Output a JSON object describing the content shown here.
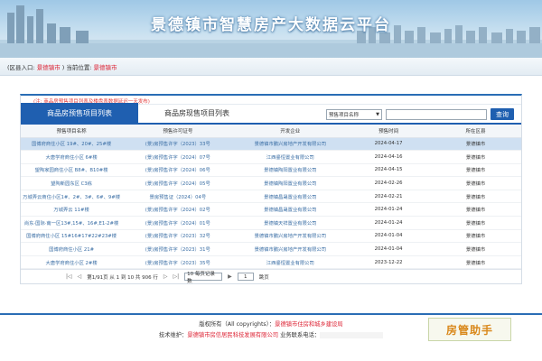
{
  "banner": {
    "title": "景德镇市智慧房产大数据云平台"
  },
  "location": {
    "region_prefix": "(区县入口:",
    "region_link": "景德镇市",
    "current_prefix": ")   当前位置:",
    "current_link": "景德镇市"
  },
  "note": "(注: 商品房预售项目列表及楼盘表数据延迟一天发布)",
  "tabs": [
    {
      "label": "商品房预售项目列表",
      "active": true
    },
    {
      "label": "商品房现售项目列表",
      "active": false
    }
  ],
  "search": {
    "select_value": "预售项目名称",
    "input_value": "",
    "button_label": "查询"
  },
  "table": {
    "headers": [
      "预售项目名称",
      "预售许可证号",
      "开发企业",
      "预售时间",
      "所在区县"
    ],
    "rows": [
      [
        "国博府商住小区 19#、20#、25#楼",
        "(景)房预售许字（2023）33号",
        "景德镇市鹏兴房地产开发有限公司",
        "2024-04-17",
        "景德镇市"
      ],
      [
        "大唐学府商住小区 6#楼",
        "(景)房预售许字（2024）07号",
        "江西鎏恒置业有限公司",
        "2024-04-16",
        "景德镇市"
      ],
      [
        "望陶家园商住小区 B8#、B10#楼",
        "(景)房预售许字（2024）06号",
        "景德镇陶阳置业有限公司",
        "2024-04-15",
        "景德镇市"
      ],
      [
        "望陶新园东区 C3栋",
        "(景)房预售许字（2024）05号",
        "景德镇陶阳置业有限公司",
        "2024-02-26",
        "景德镇市"
      ],
      [
        "万城弄云商住小区1#、2#、3#、6#、9#楼",
        "景房预售证（2024）04号",
        "景德镇昌晟置业有限公司",
        "2024-02-21",
        "景德镇市"
      ],
      [
        "万城弄云 11#楼",
        "(景)房预售许字（2024）02号",
        "景德镇昌晟置业有限公司",
        "2024-01-24",
        "景德镇市"
      ],
      [
        "尚东·国际·南一区13#,15#、16#,E1-2#楼",
        "(景)房预售许字（2024）01号",
        "景德镇天祥置业有限公司",
        "2024-01-24",
        "景德镇市"
      ],
      [
        "国博府商住小区 15#16#17#22#23#楼",
        "(景)房预售许字（2023）32号",
        "景德镇市鹏兴房地产开发有限公司",
        "2024-01-04",
        "景德镇市"
      ],
      [
        "国博府商住小区 21#",
        "(景)房预售许字（2023）31号",
        "景德镇市鹏兴房地产开发有限公司",
        "2024-01-04",
        "景德镇市"
      ],
      [
        "大唐学府商住小区 2#楼",
        "(景)房预售许字（2023）35号",
        "江西鎏恒置业有限公司",
        "2023-12-22",
        "景德镇市"
      ]
    ]
  },
  "pager": {
    "summary": "第1/91页 从 1 到 10 共 906 行",
    "page_size": "10 每页记录数",
    "goto_value": "1",
    "goto_suffix": "跳页"
  },
  "footer": {
    "copyright_prefix": "版权所有（All copyrights）：",
    "copyright_org": "景德镇市住房和城乡建设局",
    "tech_prefix": "技术维护：",
    "tech_org": "景德镇市房信居民科技发展有限公司",
    "contact_label": "业务联系电话："
  },
  "watermark": "房管助手"
}
